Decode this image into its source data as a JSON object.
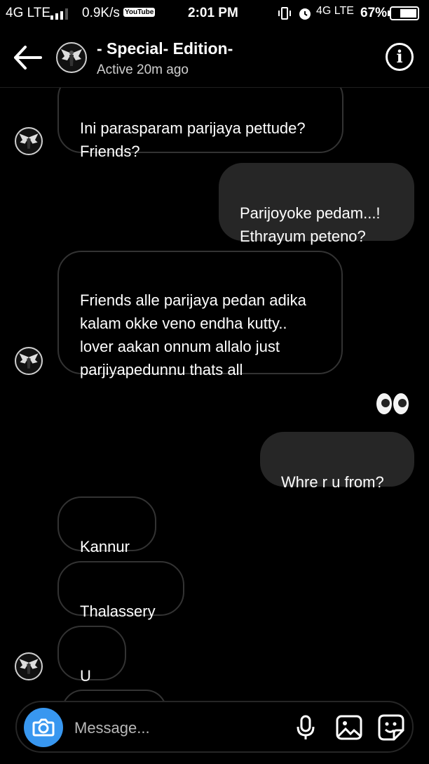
{
  "status_bar": {
    "network_left": "4G LTE",
    "speed": "0.9K/s",
    "youtube": "YouTube",
    "time": "2:01 PM",
    "network_right": "4G LTE",
    "battery": "67%"
  },
  "header": {
    "title": "- Special- Edition-",
    "subtitle": "Active 20m ago"
  },
  "messages": [
    {
      "side": "incoming",
      "text": "Ini parasparam parijaya pettude?\nFriends?"
    },
    {
      "side": "outgoing",
      "text": "Parijoyoke pedam...!\nEthrayum peteno?"
    },
    {
      "side": "incoming",
      "text": "Friends alle parijaya pedan adika\nkalam okke veno endha kutty..\nlover aakan onnum allalo just\nparjiyapedunnu thats all"
    },
    {
      "side": "outgoing",
      "reaction": "eyes-emoji"
    },
    {
      "side": "outgoing",
      "text": "Whre r u from?"
    },
    {
      "side": "incoming",
      "text": "Kannur"
    },
    {
      "side": "incoming",
      "text": "Thalassery"
    },
    {
      "side": "incoming",
      "text": "U ?"
    }
  ],
  "composer": {
    "placeholder": "Message..."
  },
  "icons": {
    "back": "back-arrow-icon",
    "info": "info-icon",
    "camera": "camera-icon",
    "mic": "microphone-icon",
    "gallery": "gallery-icon",
    "sticker": "sticker-icon"
  },
  "colors": {
    "background": "#000000",
    "outgoing_bubble": "#262626",
    "incoming_border": "#333333",
    "camera_button": "#3897f0"
  }
}
